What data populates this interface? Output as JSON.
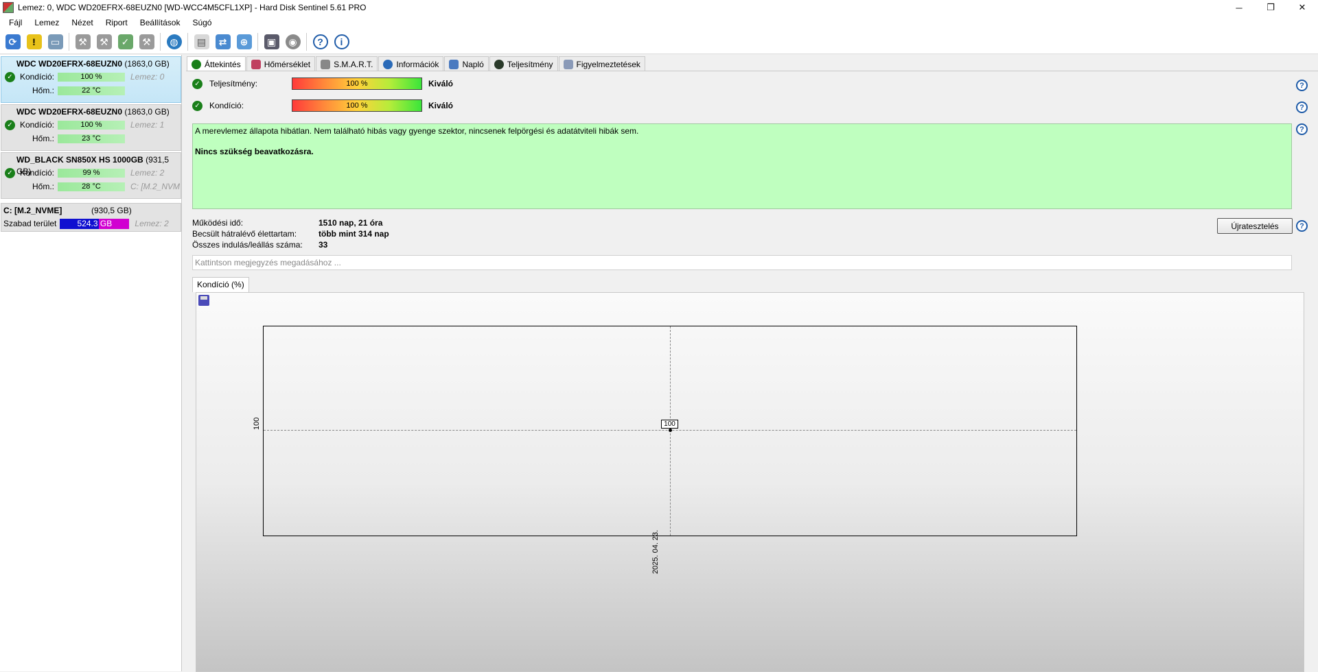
{
  "window": {
    "title": "Lemez: 0, WDC WD20EFRX-68EUZN0 [WD-WCC4M5CFL1XP]  -  Hard Disk Sentinel 5.61 PRO",
    "minimize": "─",
    "maximize": "❐",
    "close": "✕"
  },
  "menu": [
    "Fájl",
    "Lemez",
    "Nézet",
    "Riport",
    "Beállítások",
    "Súgó"
  ],
  "toolbar_icons": [
    "refresh-icon",
    "warning-icon",
    "drive-icon",
    "disk-tool-1-icon",
    "disk-tool-2-icon",
    "disk-check-icon",
    "disk-tool-3-icon",
    "globe-icon",
    "report-icon",
    "sync-icon",
    "network-icon",
    "monitor-icon",
    "speaker-icon",
    "help-icon",
    "info-icon"
  ],
  "disks": [
    {
      "name": "WDC WD20EFRX-68EUZN0",
      "size": "(1863,0 GB)",
      "condition_label": "Kondíció:",
      "condition": "100 %",
      "meta1": "Lemez: 0",
      "temp_label": "Hőm.:",
      "temp": "22 °C",
      "meta2": ""
    },
    {
      "name": "WDC WD20EFRX-68EUZN0",
      "size": "(1863,0 GB)",
      "condition_label": "Kondíció:",
      "condition": "100 %",
      "meta1": "Lemez: 1",
      "temp_label": "Hőm.:",
      "temp": "23 °C",
      "meta2": ""
    },
    {
      "name": "WD_BLACK SN850X HS 1000GB",
      "size": "(931,5 GB)",
      "condition_label": "Kondíció:",
      "condition": "99 %",
      "meta1": "Lemez: 2",
      "temp_label": "Hőm.:",
      "temp": "28 °C",
      "meta2": "C: [M.2_NVM"
    }
  ],
  "volume": {
    "name": "C: [M.2_NVME]",
    "size": "(930,5 GB)",
    "free_label": "Szabad terület",
    "free": "524.3 GB",
    "free_fraction": 0.56,
    "meta": "Lemez: 2"
  },
  "tabs": [
    "Áttekintés",
    "Hőmérséklet",
    "S.M.A.R.T.",
    "Információk",
    "Napló",
    "Teljesítmény",
    "Figyelmeztetések"
  ],
  "overview": {
    "performance_label": "Teljesítmény:",
    "performance_value": "100 %",
    "performance_word": "Kiváló",
    "condition_label": "Kondíció:",
    "condition_value": "100 %",
    "condition_word": "Kiváló",
    "message": "A merevlemez állapota hibátlan. Nem található hibás vagy gyenge szektor, nincsenek felpörgési és adatátviteli hibák sem.",
    "message_bold": "Nincs szükség beavatkozásra.",
    "uptime_label": "Működési idő:",
    "uptime": "1510 nap, 21 óra",
    "lifetime_label": "Becsült hátralévő élettartam:",
    "lifetime": "több mint 314 nap",
    "starts_label": "Összes indulás/leállás száma:",
    "starts": "33",
    "reset_button": "Újratesztelés",
    "note_placeholder": "Kattintson megjegyzés megadásához ...",
    "chart_tab": "Kondíció  (%)"
  },
  "chart_data": {
    "type": "line",
    "x": [
      "2025. 04. 23."
    ],
    "values": [
      100
    ],
    "data_labels": [
      "100"
    ],
    "y_ticks": [
      "100"
    ],
    "x_ticks": [
      "2025. 04. 23."
    ],
    "grid": true
  }
}
